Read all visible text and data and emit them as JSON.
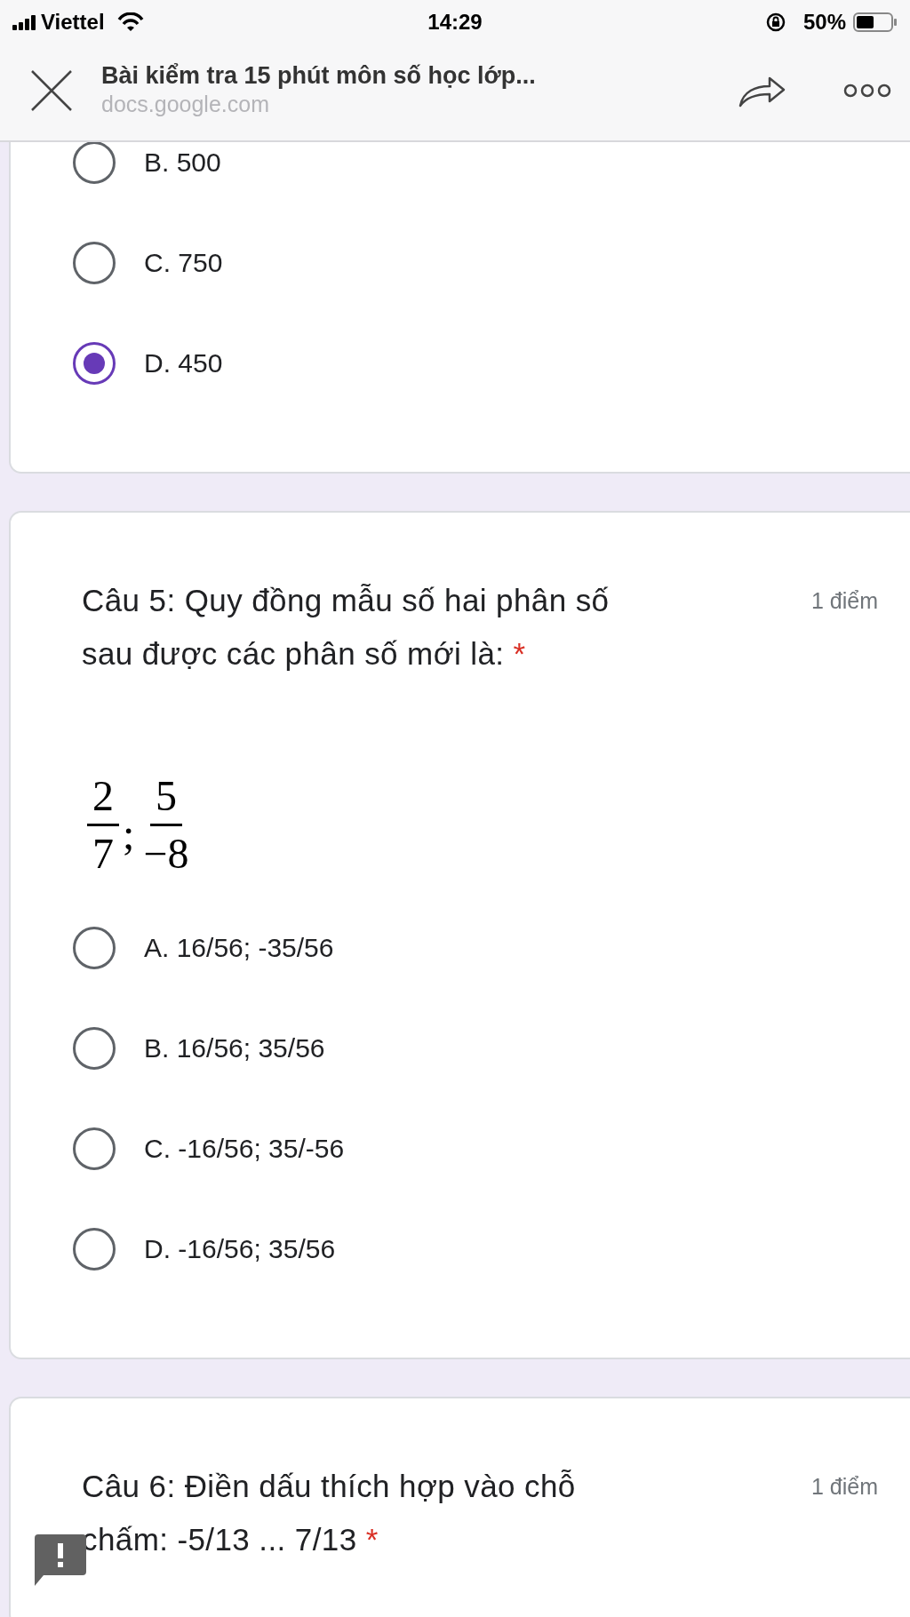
{
  "status_bar": {
    "carrier": "Viettel",
    "time": "14:29",
    "battery": "50%"
  },
  "browser_header": {
    "title": "Bài kiểm tra 15 phút môn số học lớp...",
    "url": "docs.google.com"
  },
  "questions": [
    {
      "options": [
        {
          "label": "B. 500",
          "selected": false
        },
        {
          "label": "C. 750",
          "selected": false
        },
        {
          "label": "D. 450",
          "selected": true
        }
      ]
    },
    {
      "title": "Câu 5: Quy đồng mẫu số hai phân số sau được các phân số mới là:",
      "required_mark": "*",
      "points": "1 điểm",
      "fractions": {
        "separator": ";",
        "items": [
          {
            "numerator": "2",
            "denominator": "7"
          },
          {
            "numerator": "5",
            "denominator": "−8"
          }
        ]
      },
      "options": [
        {
          "label": "A. 16/56; -35/56",
          "selected": false
        },
        {
          "label": "B. 16/56; 35/56",
          "selected": false
        },
        {
          "label": "C. -16/56; 35/-56",
          "selected": false
        },
        {
          "label": "D. -16/56; 35/56",
          "selected": false
        }
      ]
    },
    {
      "title": "Câu 6: Điền dấu thích hợp vào chỗ chấm: -5/13 ... 7/13",
      "required_mark": "*",
      "points": "1 điểm"
    }
  ]
}
